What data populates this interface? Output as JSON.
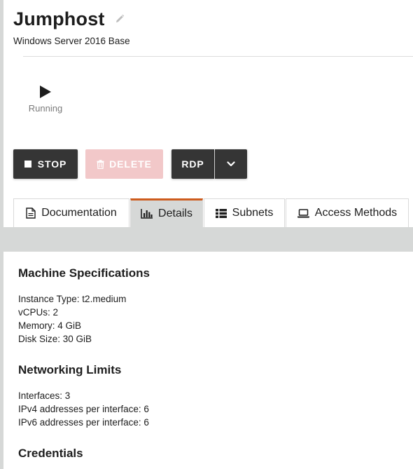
{
  "instance": {
    "name": "Jumphost",
    "image": "Windows Server 2016 Base",
    "state": "Running"
  },
  "actions": {
    "stop": "STOP",
    "delete": "DELETE",
    "rdp": "RDP"
  },
  "tabs": [
    {
      "label": "Documentation",
      "icon": "document-icon",
      "active": false
    },
    {
      "label": "Details",
      "icon": "bar-chart-icon",
      "active": true
    },
    {
      "label": "Subnets",
      "icon": "list-icon",
      "active": false
    },
    {
      "label": "Access Methods",
      "icon": "laptop-icon",
      "active": false
    }
  ],
  "details": {
    "machine_specs": {
      "title": "Machine Specifications",
      "lines": [
        "Instance Type: t2.medium",
        "vCPUs: 2",
        "Memory: 4 GiB",
        "Disk Size: 30 GiB"
      ]
    },
    "networking": {
      "title": "Networking Limits",
      "lines": [
        "Interfaces: 3",
        "IPv4 addresses per interface: 6",
        "IPv6 addresses per interface: 6"
      ]
    },
    "credentials": {
      "title": "Credentials"
    }
  },
  "colors": {
    "accent": "#cd5c1e",
    "button_dark": "#353535",
    "button_disabled": "#f2c8c9",
    "panel_gray": "#d6d8d7"
  }
}
